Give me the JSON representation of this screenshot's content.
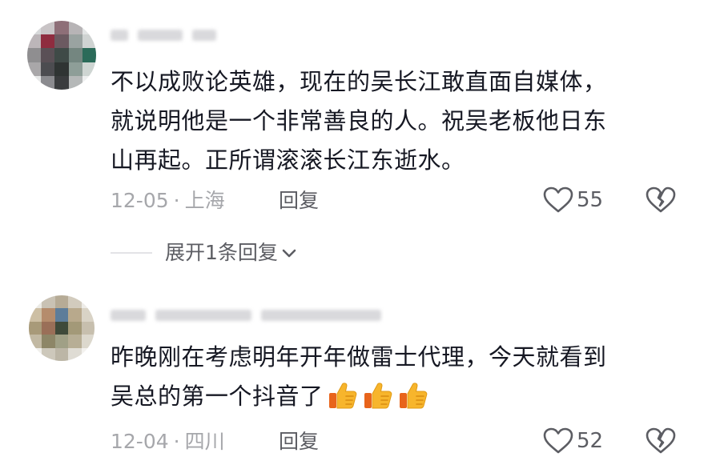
{
  "comments": [
    {
      "username": "",
      "text_lines": [
        "不以成败论英雄，现在的吴长江敢直面自媒体，",
        "就说明他是一个非常善良的人。祝吴老板他日东",
        "山再起。正所谓滚滚长江东逝水。"
      ],
      "date": "12-05",
      "location": "上海",
      "reply_label": "回复",
      "likes": "55",
      "expand_replies_label": "展开1条回复"
    },
    {
      "username": "",
      "text_lines": [
        "昨晚刚在考虑明年开年做雷士代理，今天就看到",
        "吴总的第一个抖音了"
      ],
      "emoji": "thumbs-up",
      "emoji_count": 3,
      "date": "12-04",
      "location": "四川",
      "reply_label": "回复",
      "likes": "52"
    }
  ],
  "colors": {
    "text_primary": "#161823",
    "text_secondary": "#a6a7ab",
    "text_action": "#5c5d63",
    "emoji_thumb": "#f7b52c"
  }
}
